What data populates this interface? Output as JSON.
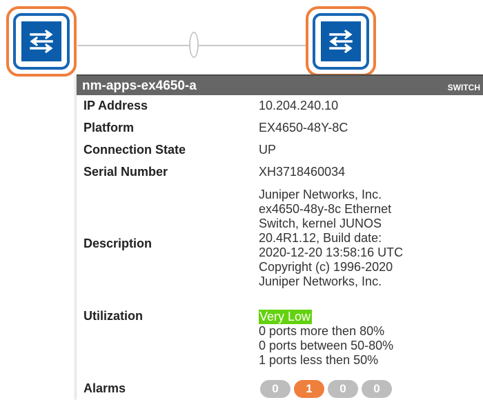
{
  "topology": {
    "nodes": [
      {
        "icon": "network-switch-icon"
      },
      {
        "icon": "network-switch-icon"
      }
    ],
    "colors": {
      "node_border": "#ef7f3d",
      "node_inner_border": "#1766b4",
      "icon_bg": "#0b5dab",
      "link": "#c8c8c8"
    }
  },
  "panel": {
    "title": "nm-apps-ex4650-a",
    "type": "SWITCH",
    "fields": {
      "ip": {
        "label": "IP Address",
        "value": "10.204.240.10"
      },
      "platform": {
        "label": "Platform",
        "value": "EX4650-48Y-8C"
      },
      "state": {
        "label": "Connection State",
        "value": "UP"
      },
      "serial": {
        "label": "Serial Number",
        "value": "XH3718460034"
      },
      "description": {
        "label": "Description",
        "lines": [
          "Juniper Networks, Inc.",
          "ex4650-48y-8c Ethernet",
          "Switch, kernel JUNOS",
          "20.4R1.12, Build date:",
          "2020-12-20 13:58:16 UTC",
          "Copyright (c) 1996-2020",
          "Juniper Networks, Inc."
        ]
      },
      "utilization": {
        "label": "Utilization",
        "level": "Very Low",
        "level_color": "#63d20e",
        "lines": [
          "0 ports more then 80%",
          "0 ports between 50-80%",
          "1 ports less then 50%"
        ]
      },
      "alarms": {
        "label": "Alarms",
        "counts": [
          {
            "value": "0",
            "color": "#bdbdbd"
          },
          {
            "value": "1",
            "color": "#ef7f3d"
          },
          {
            "value": "0",
            "color": "#bdbdbd"
          },
          {
            "value": "0",
            "color": "#bdbdbd"
          }
        ]
      }
    }
  }
}
